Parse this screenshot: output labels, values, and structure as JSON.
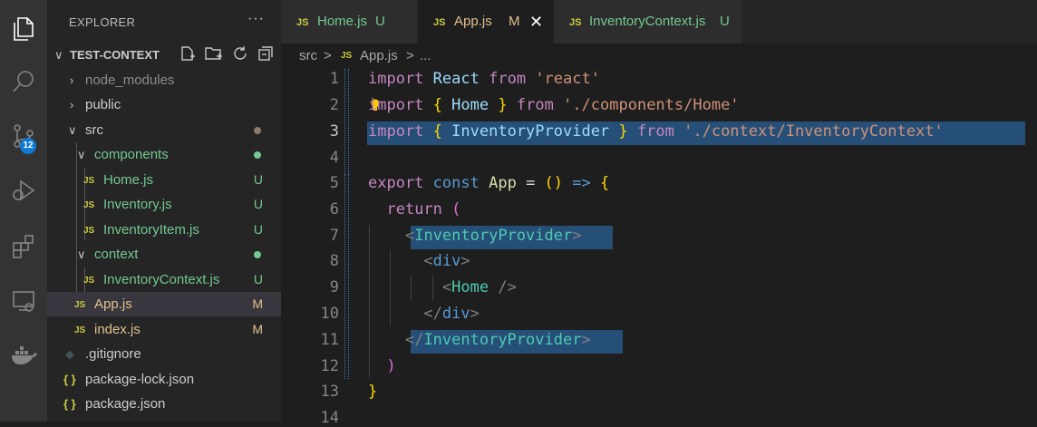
{
  "activity_bar": {
    "items": [
      "explorer-icon",
      "search-icon",
      "source-control-icon",
      "run-debug-icon",
      "extensions-icon",
      "remote-explorer-icon",
      "docker-icon"
    ],
    "scm_badge": "12"
  },
  "explorer": {
    "title": "EXPLORER",
    "more": "···",
    "project": "TEST-CONTEXT",
    "tree": [
      {
        "label": "node_modules",
        "type": "folder-collapsed",
        "color": "#8c8c8c"
      },
      {
        "label": "public",
        "type": "folder-collapsed",
        "color": "#cccccc"
      },
      {
        "label": "src",
        "type": "folder-open",
        "color": "#cccccc",
        "dot": "#8a7a6a"
      },
      {
        "label": "components",
        "type": "folder-open",
        "color": "#73c991",
        "dot": "#73c991"
      },
      {
        "label": "Home.js",
        "type": "js",
        "color": "#73c991",
        "status": "U"
      },
      {
        "label": "Inventory.js",
        "type": "js",
        "color": "#73c991",
        "status": "U"
      },
      {
        "label": "InventoryItem.js",
        "type": "js",
        "color": "#73c991",
        "status": "U"
      },
      {
        "label": "context",
        "type": "folder-open",
        "color": "#73c991",
        "dot": "#73c991"
      },
      {
        "label": "InventoryContext.js",
        "type": "js",
        "color": "#73c991",
        "status": "U"
      },
      {
        "label": "App.js",
        "type": "js",
        "color": "#e2c08d",
        "status": "M",
        "selected": true
      },
      {
        "label": "index.js",
        "type": "js",
        "color": "#e2c08d",
        "status": "M"
      },
      {
        "label": ".gitignore",
        "type": "git",
        "color": "#cccccc"
      },
      {
        "label": "package-lock.json",
        "type": "json",
        "color": "#cccccc"
      },
      {
        "label": "package.json",
        "type": "json",
        "color": "#cccccc"
      }
    ]
  },
  "tabs": [
    {
      "icon": "JS",
      "label": "Home.js",
      "status": "U",
      "color": "#73c991",
      "active": false
    },
    {
      "icon": "JS",
      "label": "App.js",
      "status": "M",
      "color": "#e2c08d",
      "active": true,
      "close": "✕"
    },
    {
      "icon": "JS",
      "label": "InventoryContext.js",
      "status": "U",
      "color": "#73c991",
      "active": false
    }
  ],
  "breadcrumb": {
    "folder": "src",
    "sep1": ">",
    "icon": "JS",
    "file": "App.js",
    "sep2": ">",
    "more": "..."
  },
  "editor": {
    "line_numbers": [
      "1",
      "2",
      "3",
      "4",
      "5",
      "6",
      "7",
      "8",
      "9",
      "10",
      "11",
      "12",
      "13",
      "14"
    ],
    "current_line": 3
  }
}
